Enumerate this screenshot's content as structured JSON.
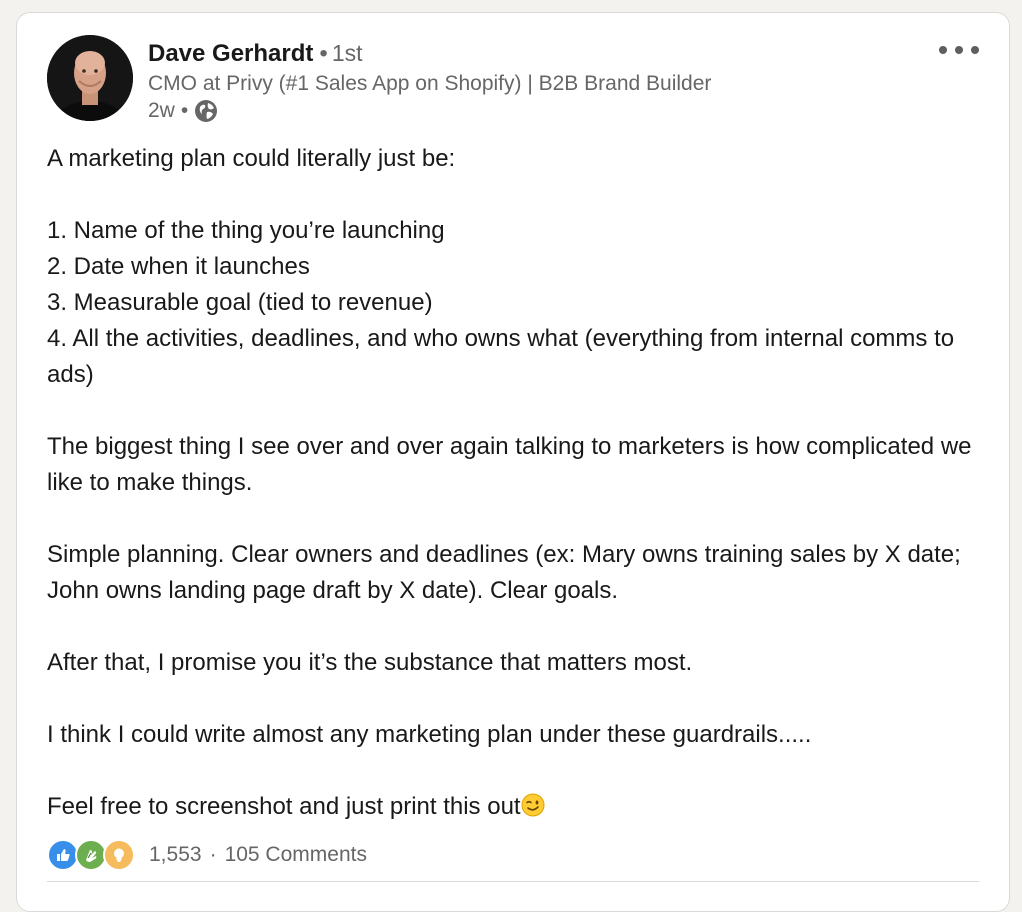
{
  "author": {
    "name": "Dave Gerhardt",
    "degree": "1st",
    "headline": "CMO at Privy (#1 Sales App on Shopify) | B2B Brand Builder",
    "posted": "2w",
    "visibility_icon": "globe-icon"
  },
  "post": {
    "lines": {
      "l1": "A marketing plan could literally just be:",
      "l2": "1. Name of the thing you’re launching",
      "l3": "2. Date when it launches",
      "l4": "3. Measurable goal (tied to revenue)",
      "l5": "4. All the activities, deadlines, and who owns what (everything from internal comms to ads)",
      "l6": "The biggest thing I see over and over again talking to marketers is how complicated we like to make things.",
      "l7": "Simple planning. Clear owners and deadlines (ex: Mary owns training sales by X date; John owns landing page draft by X date). Clear goals.",
      "l8": "After that, I promise you it’s the substance that matters most.",
      "l9": "I think I could write almost any marketing plan under these guardrails.....",
      "l10": "Feel free to screenshot and just print this out"
    },
    "emoji": "winking-face-emoji"
  },
  "social": {
    "reaction_icons": [
      "like-icon",
      "celebrate-icon",
      "insightful-icon"
    ],
    "reactions_count": "1,553",
    "separator": "·",
    "comments": "105 Comments"
  },
  "menu_icon": "more-options-icon",
  "colors": {
    "like_blue": "#378fe9",
    "celebrate_green": "#44712e",
    "insightful_yellow": "#f5bb5c",
    "text_secondary": "#666666"
  }
}
